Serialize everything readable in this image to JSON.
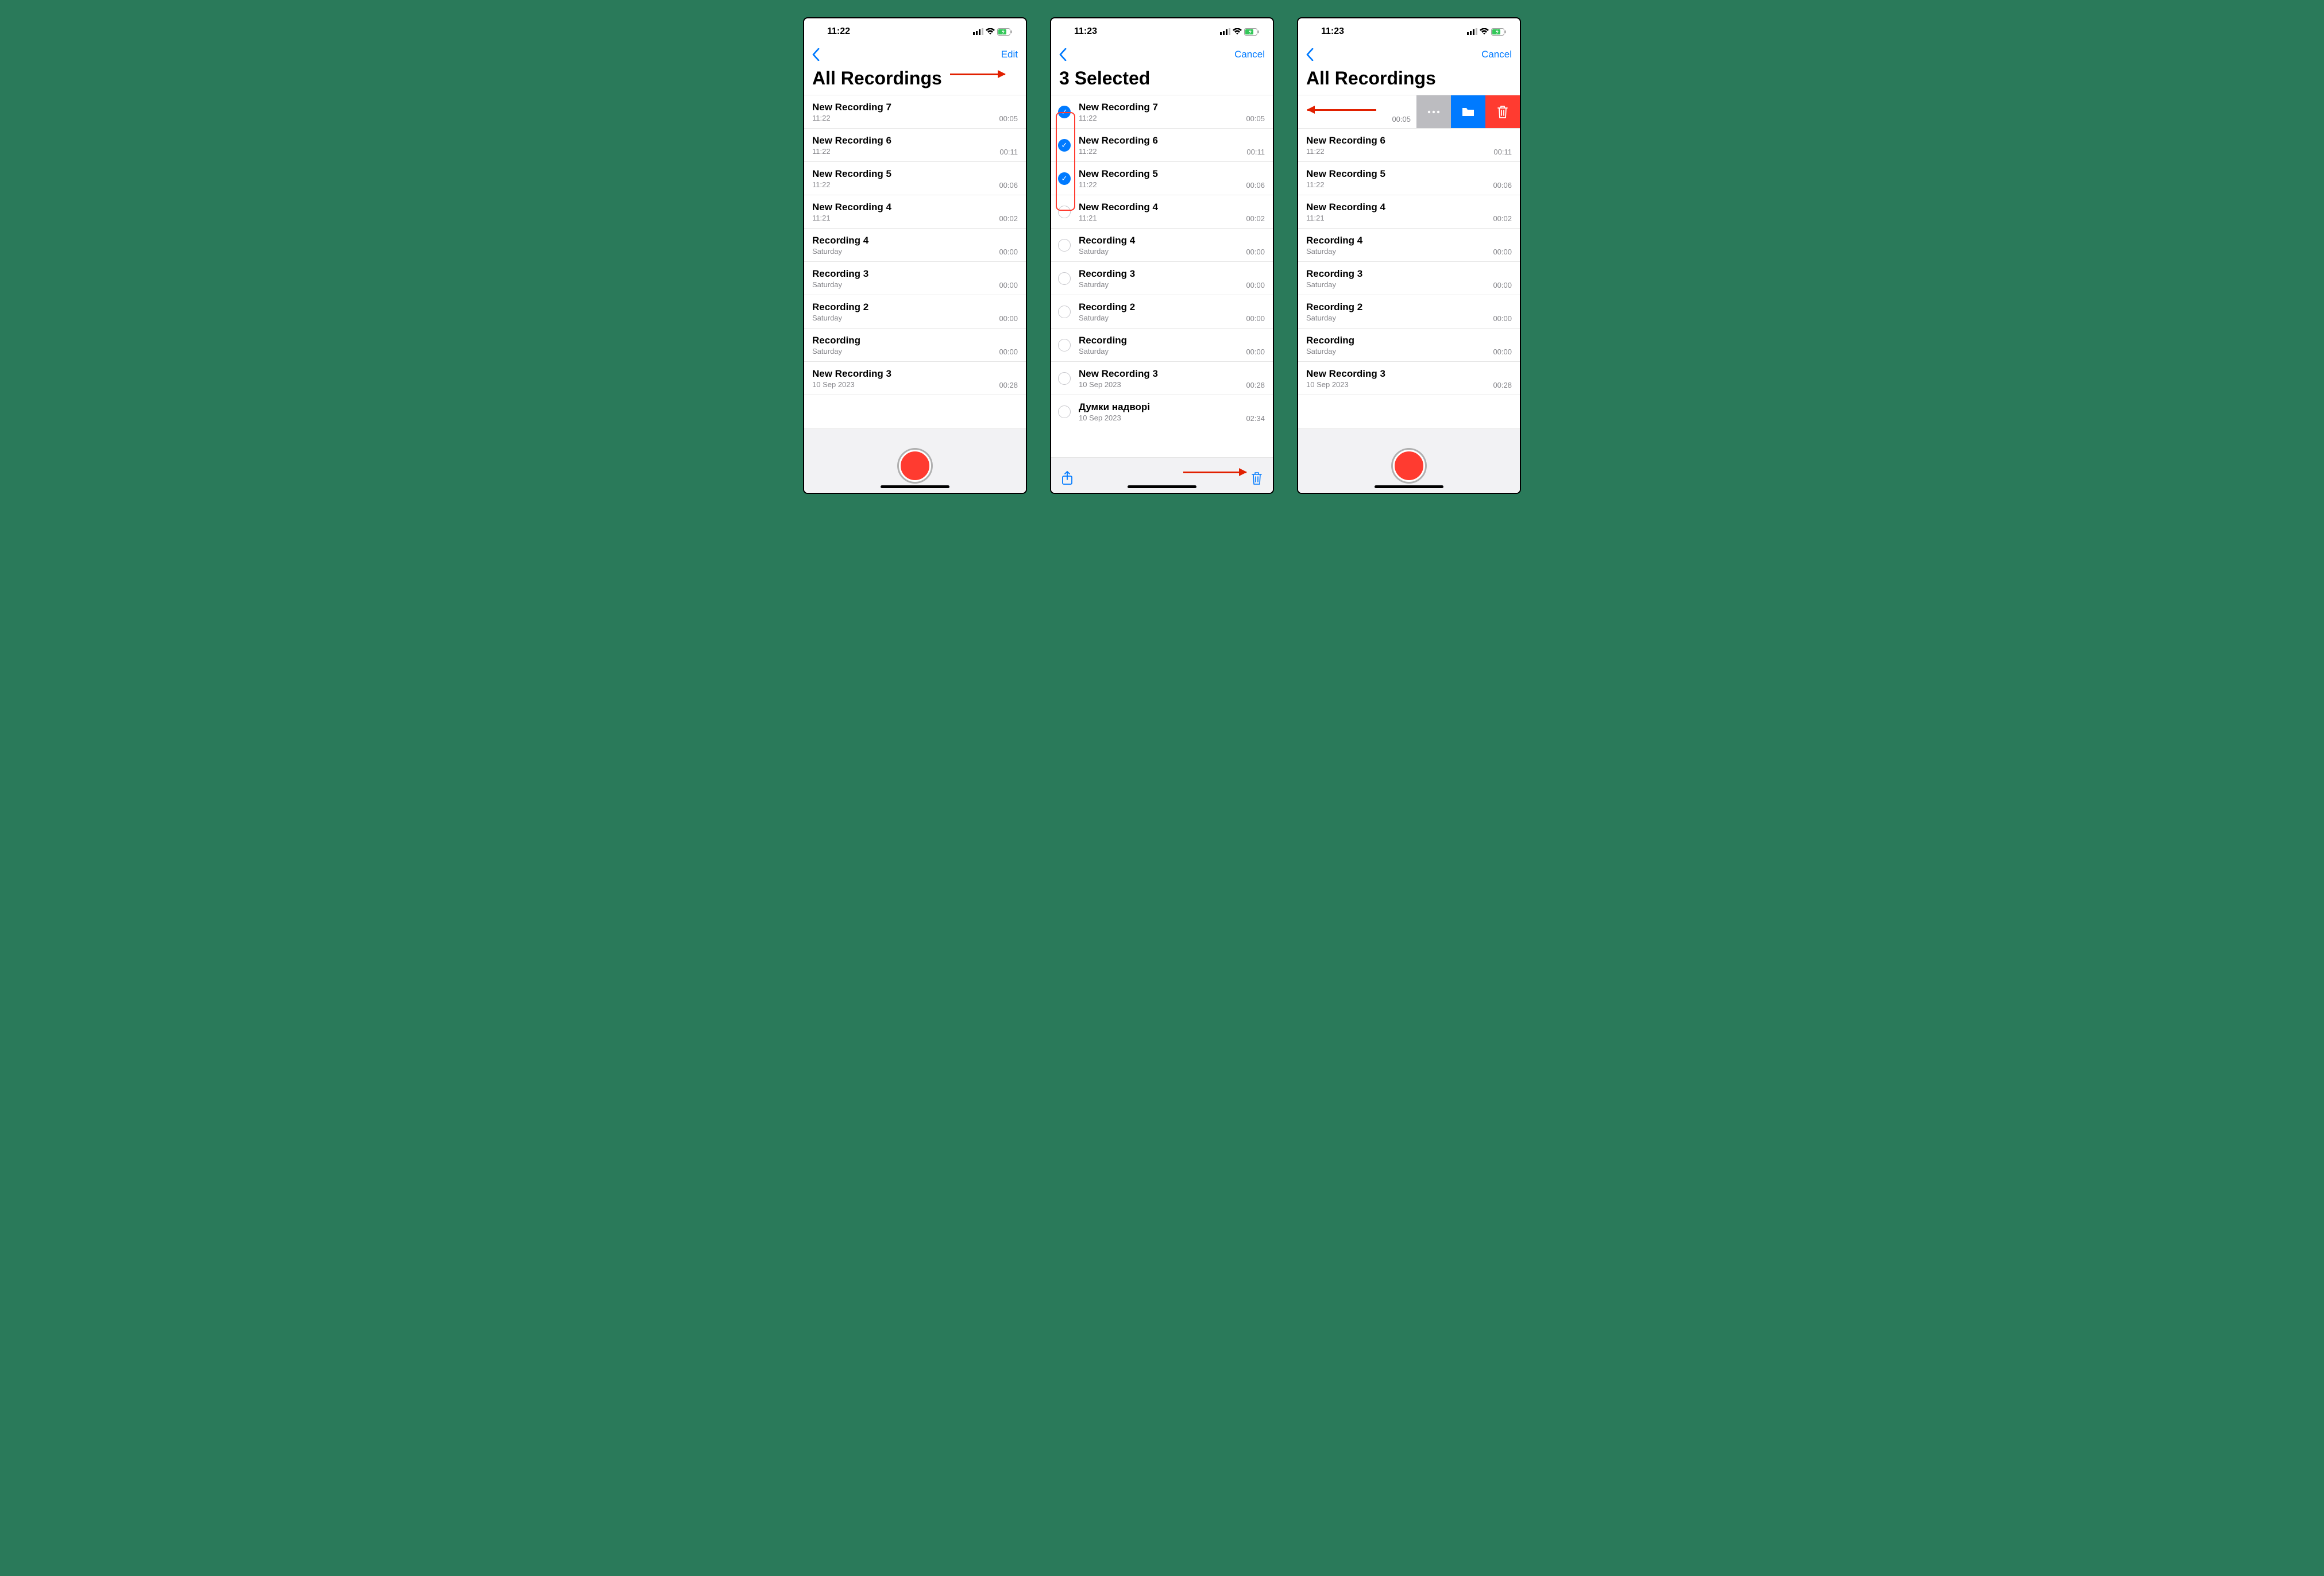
{
  "screens": {
    "s1": {
      "time": "11:22",
      "nav_right": "Edit",
      "title": "All Recordings",
      "has_record": true,
      "has_toolbar": false,
      "rows": [
        {
          "title": "New Recording 7",
          "sub": "11:22",
          "dur": "00:05"
        },
        {
          "title": "New Recording 6",
          "sub": "11:22",
          "dur": "00:11"
        },
        {
          "title": "New Recording 5",
          "sub": "11:22",
          "dur": "00:06"
        },
        {
          "title": "New Recording 4",
          "sub": "11:21",
          "dur": "00:02"
        },
        {
          "title": "Recording 4",
          "sub": "Saturday",
          "dur": "00:00"
        },
        {
          "title": "Recording 3",
          "sub": "Saturday",
          "dur": "00:00"
        },
        {
          "title": "Recording 2",
          "sub": "Saturday",
          "dur": "00:00"
        },
        {
          "title": "Recording",
          "sub": "Saturday",
          "dur": "00:00"
        },
        {
          "title": "New Recording 3",
          "sub": "10 Sep 2023",
          "dur": "00:28"
        }
      ]
    },
    "s2": {
      "time": "11:23",
      "nav_right": "Cancel",
      "title": "3 Selected",
      "has_record": false,
      "has_toolbar": true,
      "rows": [
        {
          "title": "New Recording 7",
          "sub": "11:22",
          "dur": "00:05",
          "sel": true
        },
        {
          "title": "New Recording 6",
          "sub": "11:22",
          "dur": "00:11",
          "sel": true
        },
        {
          "title": "New Recording 5",
          "sub": "11:22",
          "dur": "00:06",
          "sel": true
        },
        {
          "title": "New Recording 4",
          "sub": "11:21",
          "dur": "00:02",
          "sel": false
        },
        {
          "title": "Recording 4",
          "sub": "Saturday",
          "dur": "00:00",
          "sel": false
        },
        {
          "title": "Recording 3",
          "sub": "Saturday",
          "dur": "00:00",
          "sel": false
        },
        {
          "title": "Recording 2",
          "sub": "Saturday",
          "dur": "00:00",
          "sel": false
        },
        {
          "title": "Recording",
          "sub": "Saturday",
          "dur": "00:00",
          "sel": false
        },
        {
          "title": "New Recording 3",
          "sub": "10 Sep 2023",
          "dur": "00:28",
          "sel": false
        },
        {
          "title": "Думки надворі",
          "sub": "10 Sep 2023",
          "dur": "02:34",
          "sel": false
        }
      ]
    },
    "s3": {
      "time": "11:23",
      "nav_right": "Cancel",
      "title": "All Recordings",
      "has_record": true,
      "has_toolbar": false,
      "swipe_dur": "00:05",
      "rows": [
        {
          "title": "New Recording 6",
          "sub": "11:22",
          "dur": "00:11"
        },
        {
          "title": "New Recording 5",
          "sub": "11:22",
          "dur": "00:06"
        },
        {
          "title": "New Recording 4",
          "sub": "11:21",
          "dur": "00:02"
        },
        {
          "title": "Recording 4",
          "sub": "Saturday",
          "dur": "00:00"
        },
        {
          "title": "Recording 3",
          "sub": "Saturday",
          "dur": "00:00"
        },
        {
          "title": "Recording 2",
          "sub": "Saturday",
          "dur": "00:00"
        },
        {
          "title": "Recording",
          "sub": "Saturday",
          "dur": "00:00"
        },
        {
          "title": "New Recording 3",
          "sub": "10 Sep 2023",
          "dur": "00:28"
        }
      ]
    }
  }
}
